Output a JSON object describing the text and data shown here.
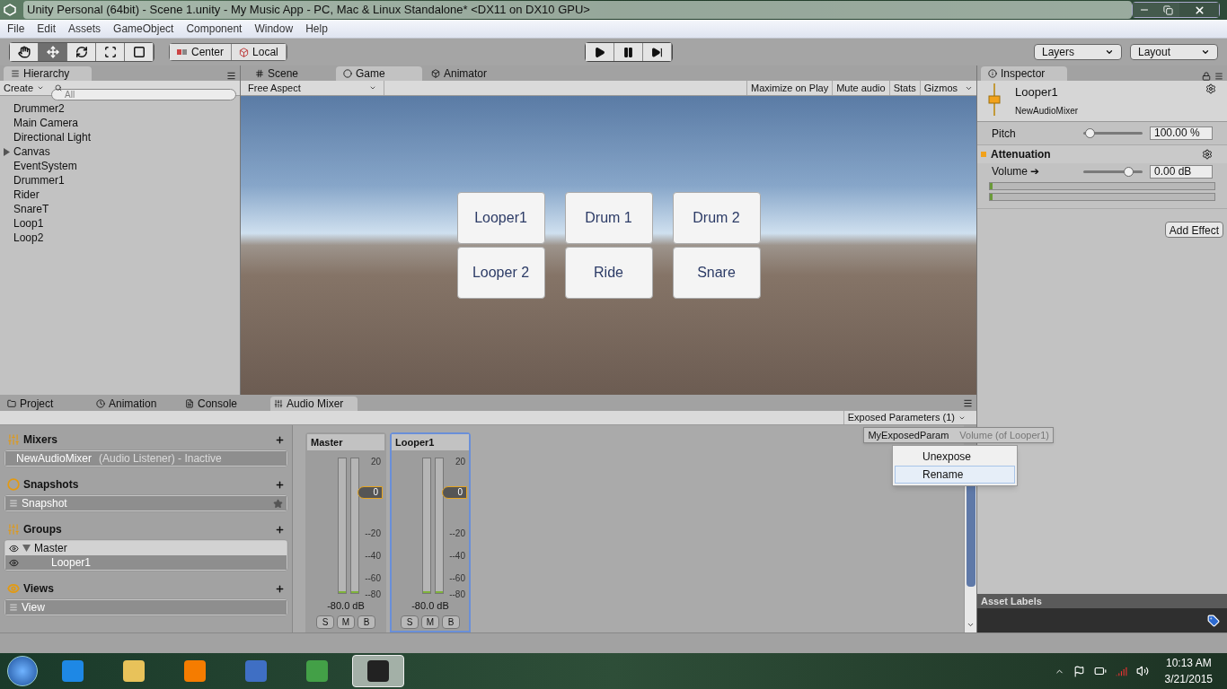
{
  "window": {
    "title": "Unity Personal (64bit) - Scene 1.unity - My Music App - PC, Mac & Linux Standalone* <DX11 on DX10 GPU>"
  },
  "menu": [
    "File",
    "Edit",
    "Assets",
    "GameObject",
    "Component",
    "Window",
    "Help"
  ],
  "toolbar": {
    "tools": [
      {
        "kind": "hand",
        "selected": false
      },
      {
        "kind": "move",
        "selected": true
      },
      {
        "kind": "rotate",
        "selected": false
      },
      {
        "kind": "scale",
        "selected": false
      },
      {
        "kind": "rect",
        "selected": false
      }
    ],
    "pivot": [
      {
        "kind": "center",
        "label": "Center"
      },
      {
        "kind": "local",
        "label": "Local"
      }
    ],
    "playback": [
      {
        "kind": "play"
      },
      {
        "kind": "pause"
      },
      {
        "kind": "step"
      }
    ],
    "layers": "Layers",
    "layout": "Layout"
  },
  "hierarchy": {
    "tab": "Hierarchy",
    "create": "Create",
    "search_placeholder": "All",
    "items": [
      {
        "label": "Drummer2",
        "expandable": false
      },
      {
        "label": "Main Camera",
        "expandable": false
      },
      {
        "label": "Directional Light",
        "expandable": false
      },
      {
        "label": "Canvas",
        "expandable": true
      },
      {
        "label": "EventSystem",
        "expandable": false
      },
      {
        "label": "Drummer1",
        "expandable": false
      },
      {
        "label": "Rider",
        "expandable": false
      },
      {
        "label": "SnareT",
        "expandable": false
      },
      {
        "label": "Loop1",
        "expandable": false
      },
      {
        "label": "Loop2",
        "expandable": false
      }
    ]
  },
  "view_tabs": [
    {
      "kind": "scene",
      "label": "Scene",
      "selected": false
    },
    {
      "kind": "game",
      "label": "Game",
      "selected": true
    },
    {
      "kind": "animator",
      "label": "Animator",
      "selected": false
    }
  ],
  "game_toolbar": {
    "aspect": "Free Aspect",
    "buttons": [
      "Maximize on Play",
      "Mute audio",
      "Stats",
      "Gizmos"
    ]
  },
  "game_buttons": [
    "Looper1",
    "Drum 1",
    "Drum 2",
    "Looper 2",
    "Ride",
    "Snare"
  ],
  "inspector": {
    "tab": "Inspector",
    "name": "Looper1",
    "subtitle": "NewAudioMixer",
    "pitch": {
      "label": "Pitch",
      "level": 0.1,
      "value": "100.00 %"
    },
    "attenuation": {
      "title": "Attenuation",
      "label": "Volume ➔",
      "level": 0.75,
      "value": "0.00 dB",
      "meters": [
        {
          "level": 0.01
        },
        {
          "level": 0.01
        }
      ]
    },
    "add_effect": "Add Effect",
    "asset_labels": "Asset Labels"
  },
  "bottom_tabs": [
    {
      "kind": "project",
      "label": "Project",
      "selected": false
    },
    {
      "kind": "animation",
      "label": "Animation",
      "selected": false
    },
    {
      "kind": "console",
      "label": "Console",
      "selected": false
    },
    {
      "kind": "mixer",
      "label": "Audio Mixer",
      "selected": true
    }
  ],
  "mixer": {
    "mixers": {
      "title": "Mixers",
      "items": [
        {
          "name": "NewAudioMixer",
          "detail": "(Audio Listener) - Inactive"
        }
      ]
    },
    "snapshots": {
      "title": "Snapshots",
      "items": [
        {
          "label": "Snapshot",
          "starred": true
        }
      ]
    },
    "groups": {
      "title": "Groups",
      "items": [
        {
          "label": "Master",
          "expanded": true,
          "selected": false,
          "children": [
            {
              "label": "Looper1",
              "selected": true
            }
          ]
        }
      ]
    },
    "views": {
      "title": "Views",
      "items": [
        {
          "label": "View"
        }
      ]
    },
    "strips": [
      {
        "name": "Master",
        "selected": false,
        "fader": "0",
        "scale": [
          "20",
          "--20",
          "--40",
          "--60",
          "--80"
        ],
        "reading": "-80.0 dB",
        "buttons": [
          "S",
          "M",
          "B"
        ]
      },
      {
        "name": "Looper1",
        "selected": true,
        "fader": "0",
        "scale": [
          "20",
          "--20",
          "--40",
          "--60",
          "--80"
        ],
        "reading": "-80.0 dB",
        "buttons": [
          "S",
          "M",
          "B"
        ]
      }
    ],
    "exposed": {
      "button": "Exposed Parameters (1)",
      "param": "MyExposedParam",
      "detail": "Volume (of Looper1)"
    },
    "context_menu": [
      {
        "label": "Unexpose",
        "selected": false
      },
      {
        "label": "Rename",
        "selected": true
      }
    ]
  },
  "taskbar": {
    "apps": [
      {
        "kind": "ie",
        "selected": false
      },
      {
        "kind": "explorer",
        "selected": false
      },
      {
        "kind": "media",
        "selected": false
      },
      {
        "kind": "paint",
        "selected": false
      },
      {
        "kind": "chrome",
        "selected": false
      },
      {
        "kind": "unity",
        "selected": true
      }
    ],
    "time": "10:13 AM",
    "date": "3/21/2015"
  }
}
